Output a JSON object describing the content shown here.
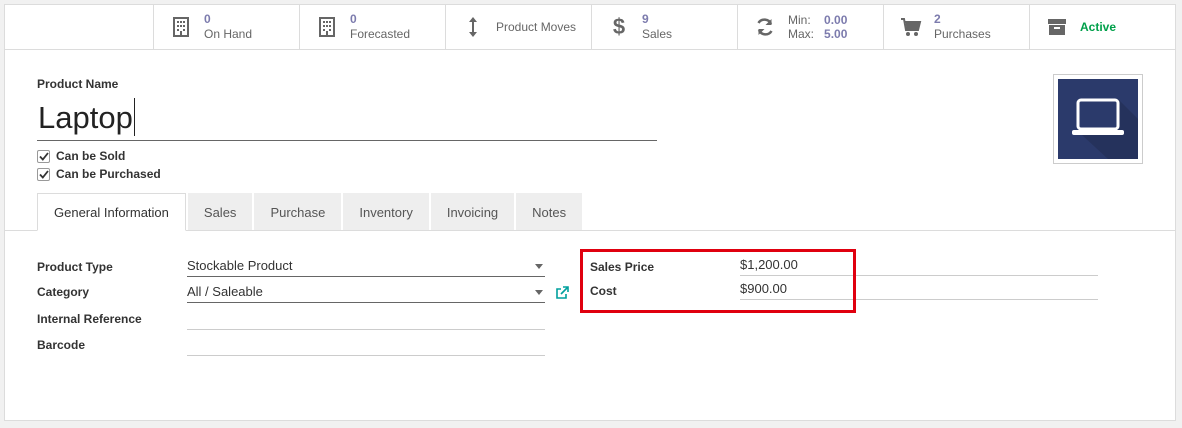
{
  "smart_buttons": {
    "on_hand": {
      "value": "0",
      "label": "On Hand"
    },
    "forecasted": {
      "value": "0",
      "label": "Forecasted"
    },
    "product_moves": {
      "label": "Product Moves"
    },
    "sales": {
      "value": "9",
      "label": "Sales"
    },
    "reordering": {
      "min_label": "Min:",
      "min_value": "0.00",
      "max_label": "Max:",
      "max_value": "5.00"
    },
    "purchases": {
      "value": "2",
      "label": "Purchases"
    },
    "archive": {
      "label": "Active"
    }
  },
  "product": {
    "name_label": "Product Name",
    "name": "Laptop",
    "can_be_sold": "Can be Sold",
    "can_be_purchased": "Can be Purchased"
  },
  "tabs": [
    "General Information",
    "Sales",
    "Purchase",
    "Inventory",
    "Invoicing",
    "Notes"
  ],
  "general": {
    "product_type_label": "Product Type",
    "product_type": "Stockable Product",
    "category_label": "Category",
    "category": "All / Saleable",
    "internal_ref_label": "Internal Reference",
    "internal_ref": "",
    "barcode_label": "Barcode",
    "barcode": "",
    "sales_price_label": "Sales Price",
    "sales_price": "$1,200.00",
    "cost_label": "Cost",
    "cost": "$900.00"
  },
  "colors": {
    "highlight": "#e0000f",
    "accent": "#7c7bad",
    "active": "#00a04a"
  }
}
